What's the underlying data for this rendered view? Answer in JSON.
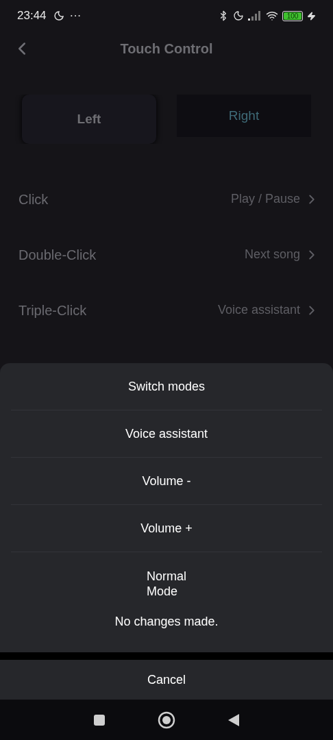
{
  "status_bar": {
    "time": "23:44",
    "more": "···",
    "battery": "100"
  },
  "header": {
    "title": "Touch Control"
  },
  "tabs": [
    {
      "label": "Left",
      "selected": true
    },
    {
      "label": "Right",
      "selected": false
    }
  ],
  "settings": [
    {
      "label": "Click",
      "value": "Play / Pause"
    },
    {
      "label": "Double-Click",
      "value": "Next song"
    },
    {
      "label": "Triple-Click",
      "value": "Voice assistant"
    }
  ],
  "sheet": {
    "options": [
      "Switch modes",
      "Voice assistant",
      "Volume -",
      "Volume +",
      "Normal\nMode"
    ],
    "toast": "No changes made.",
    "cancel": "Cancel"
  }
}
